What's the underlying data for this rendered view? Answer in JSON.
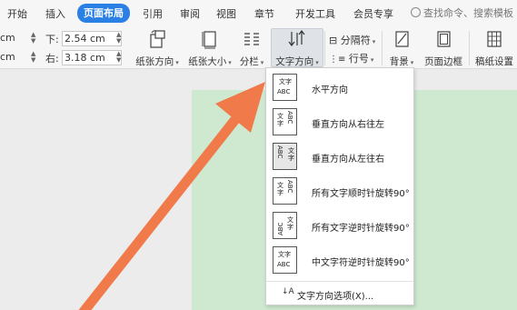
{
  "menu": {
    "items": [
      "开始",
      "插入",
      "页面布局",
      "引用",
      "审阅",
      "视图",
      "章节",
      "开发工具",
      "会员专享"
    ],
    "active_index": 2,
    "active_color": "#2b80e6",
    "search_placeholder": "查找命令、搜索模板"
  },
  "margins": {
    "unit_top": "cm",
    "unit_bottom": "cm",
    "down_label": "下:",
    "down_value": "2.54 cm",
    "right_label": "右:",
    "right_value": "3.18 cm"
  },
  "toolbar": {
    "paper_orientation": "纸张方向",
    "paper_size": "纸张大小",
    "columns": "分栏",
    "text_direction": "文字方向",
    "separator": "分隔符",
    "line_number": "行号",
    "background": "背景",
    "page_border": "页面边框",
    "manuscript": "稿纸设置"
  },
  "dropdown": {
    "items": [
      {
        "label": "水平方向",
        "icon": "horizontal-text-icon"
      },
      {
        "label": "垂直方向从右往左",
        "icon": "vertical-rtl-text-icon"
      },
      {
        "label": "垂直方向从左往右",
        "icon": "vertical-ltr-text-icon"
      },
      {
        "label": "所有文字顺时针旋转90°",
        "icon": "rotate-cw-text-icon"
      },
      {
        "label": "所有文字逆时针旋转90°",
        "icon": "rotate-ccw-text-icon"
      },
      {
        "label": "中文字符逆时针旋转90°",
        "icon": "cjk-rotate-ccw-text-icon"
      }
    ],
    "selected_index": 2,
    "footer": "文字方向选项(X)..."
  },
  "glyphs": {
    "wen": "文",
    "zi": "字",
    "abc": "ABC"
  },
  "colors": {
    "page": "#cfe9d1",
    "arrow": "#f07a4a"
  }
}
